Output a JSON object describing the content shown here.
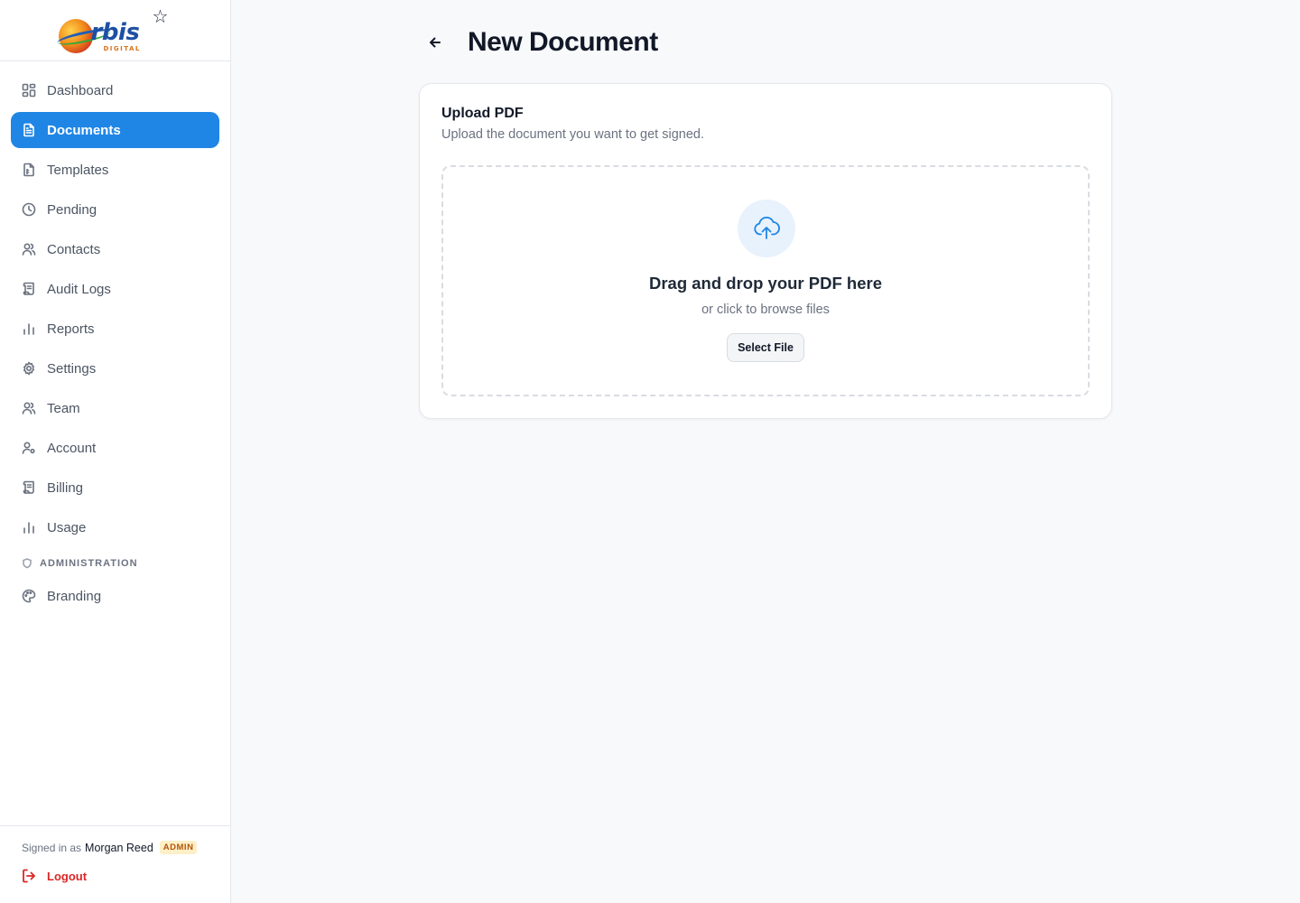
{
  "brand": {
    "name": "rbis",
    "sub": "DIGITAL"
  },
  "nav": {
    "items": [
      {
        "label": "Dashboard",
        "icon": "dashboard-icon",
        "active": false
      },
      {
        "label": "Documents",
        "icon": "document-icon",
        "active": true
      },
      {
        "label": "Templates",
        "icon": "template-icon",
        "active": false
      },
      {
        "label": "Pending",
        "icon": "clock-icon",
        "active": false
      },
      {
        "label": "Contacts",
        "icon": "users-icon",
        "active": false
      },
      {
        "label": "Audit Logs",
        "icon": "scroll-icon",
        "active": false
      },
      {
        "label": "Reports",
        "icon": "bar-chart-icon",
        "active": false
      },
      {
        "label": "Settings",
        "icon": "gear-icon",
        "active": false
      },
      {
        "label": "Team",
        "icon": "users-icon",
        "active": false
      },
      {
        "label": "Account",
        "icon": "user-cog-icon",
        "active": false
      },
      {
        "label": "Billing",
        "icon": "scroll-icon",
        "active": false
      },
      {
        "label": "Usage",
        "icon": "bar-chart-icon",
        "active": false
      }
    ],
    "admin_section": "ADMINISTRATION",
    "admin_items": [
      {
        "label": "Branding",
        "icon": "palette-icon",
        "active": false
      }
    ]
  },
  "footer": {
    "signed_in_prefix": "Signed in as",
    "user_name": "Morgan Reed",
    "role_badge": "ADMIN",
    "logout_label": "Logout"
  },
  "page": {
    "title": "New Document"
  },
  "upload": {
    "title": "Upload PDF",
    "description": "Upload the document you want to get signed.",
    "dropzone_title": "Drag and drop your PDF here",
    "dropzone_sub": "or click to browse files",
    "button_label": "Select File"
  },
  "colors": {
    "accent": "#1f86e5",
    "danger": "#dc2626",
    "badge_bg": "#fdf0c8",
    "badge_text": "#b45309"
  }
}
